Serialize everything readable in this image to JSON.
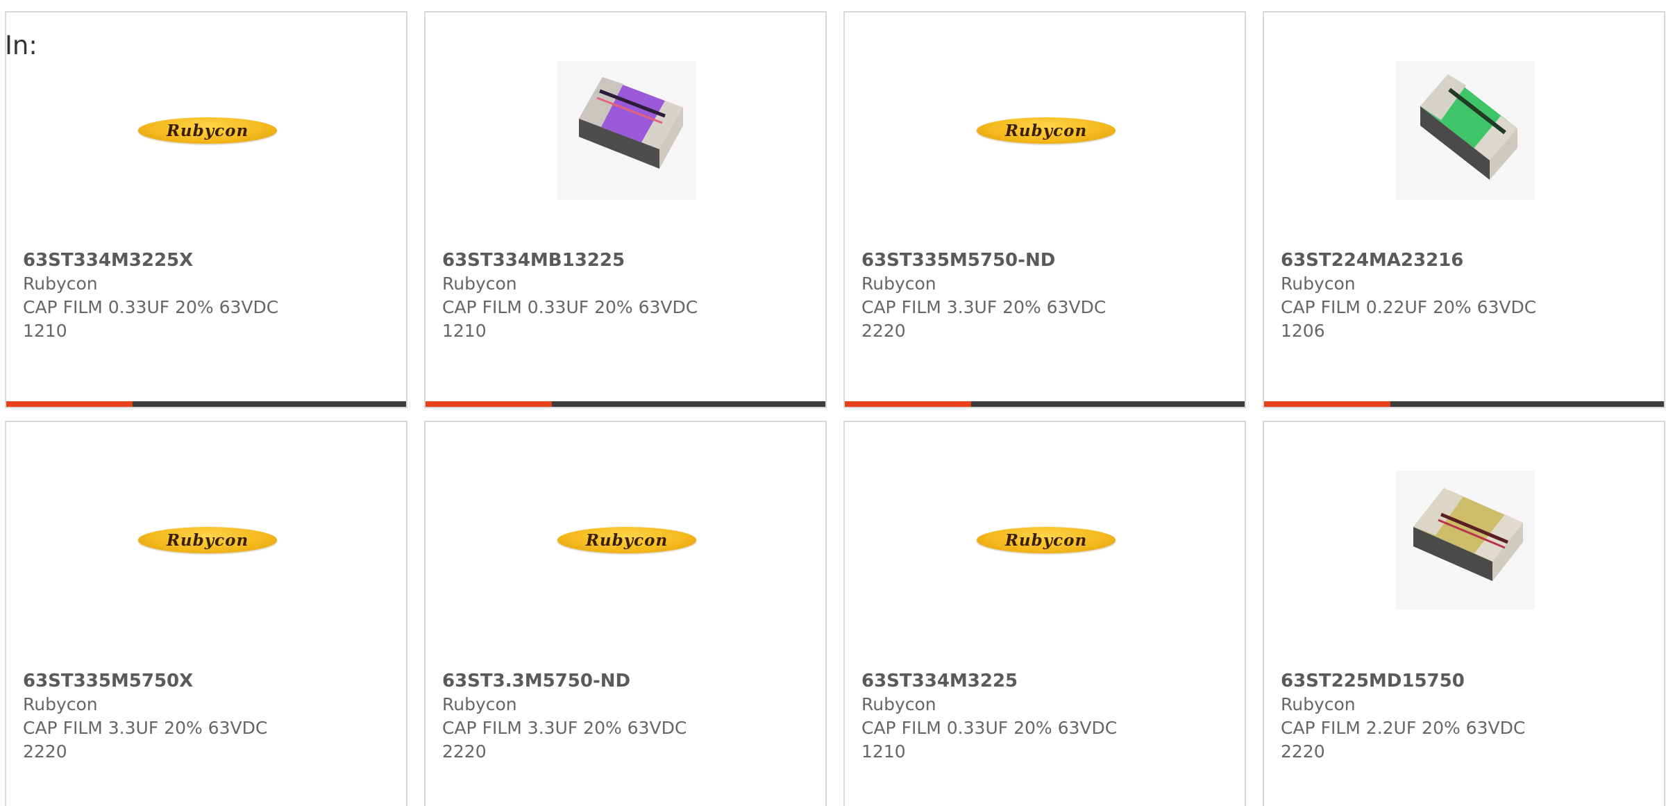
{
  "header": {
    "in_label": "In:"
  },
  "colors": {
    "accent": "#e8411a",
    "bar_dark": "#3d3d3d",
    "card_border": "#d8d8d8"
  },
  "products": [
    {
      "part": "63ST334M3225X",
      "maker": "Rubycon",
      "desc": "CAP FILM 0.33UF 20% 63VDC",
      "pkg": "1210",
      "image": "rubycon-logo"
    },
    {
      "part": "63ST334MB13225",
      "maker": "Rubycon",
      "desc": "CAP FILM 0.33UF 20% 63VDC",
      "pkg": "1210",
      "image": "chip-purple"
    },
    {
      "part": "63ST335M5750-ND",
      "maker": "Rubycon",
      "desc": "CAP FILM 3.3UF 20% 63VDC",
      "pkg": "2220",
      "image": "rubycon-logo"
    },
    {
      "part": "63ST224MA23216",
      "maker": "Rubycon",
      "desc": "CAP FILM 0.22UF 20% 63VDC",
      "pkg": "1206",
      "image": "chip-green"
    },
    {
      "part": "63ST335M5750X",
      "maker": "Rubycon",
      "desc": "CAP FILM 3.3UF 20% 63VDC",
      "pkg": "2220",
      "image": "rubycon-logo"
    },
    {
      "part": "63ST3.3M5750-ND",
      "maker": "Rubycon",
      "desc": "CAP FILM 3.3UF 20% 63VDC",
      "pkg": "2220",
      "image": "rubycon-logo"
    },
    {
      "part": "63ST334M3225",
      "maker": "Rubycon",
      "desc": "CAP FILM 0.33UF 20% 63VDC",
      "pkg": "1210",
      "image": "rubycon-logo"
    },
    {
      "part": "63ST225MD15750",
      "maker": "Rubycon",
      "desc": "CAP FILM 2.2UF 20% 63VDC",
      "pkg": "2220",
      "image": "chip-gold"
    }
  ],
  "logo_text": "Rubycon"
}
